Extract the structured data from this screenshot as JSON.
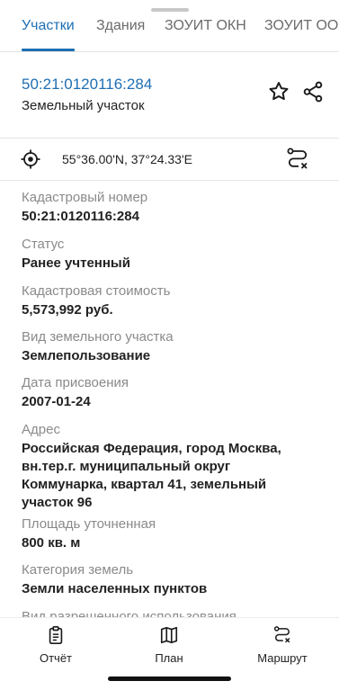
{
  "tabs": [
    {
      "label": "Участки",
      "active": true
    },
    {
      "label": "Здания",
      "active": false
    },
    {
      "label": "ЗОУИТ ОКН",
      "active": false
    },
    {
      "label": "ЗОУИТ ООВ",
      "active": false
    }
  ],
  "header": {
    "cadastral_link": "50:21:0120116:284",
    "object_type": "Земельный участок",
    "icons": [
      "star-icon",
      "share-icon"
    ]
  },
  "coords": {
    "text": "55°36.00'N, 37°24.33'E",
    "icons": [
      "crosshair-icon",
      "route-clear-icon"
    ]
  },
  "details": [
    {
      "label": "Кадастровый номер",
      "value": "50:21:0120116:284"
    },
    {
      "label": "Статус",
      "value": "Ранее учтенный"
    },
    {
      "label": "Кадастровая стоимость",
      "value": "5,573,992 руб."
    },
    {
      "label": "Вид земельного участка",
      "value": "Землепользование"
    },
    {
      "label": "Дата присвоения",
      "value": "2007-01-24"
    },
    {
      "label": "Адрес",
      "value": "Российская Федерация, город Москва, вн.тер.г. муниципальный округ Коммунарка, квартал 41, земельный участок 96"
    },
    {
      "label": "Площадь уточненная",
      "value": "800 кв. м"
    },
    {
      "label": "Категория земель",
      "value": "Земли населенных пунктов"
    },
    {
      "label": "Вид разрешенного использования",
      "value": ""
    }
  ],
  "bottom_nav": [
    {
      "label": "Отчёт",
      "icon": "report-icon"
    },
    {
      "label": "План",
      "icon": "map-icon"
    },
    {
      "label": "Маршрут",
      "icon": "route-icon"
    }
  ],
  "colors": {
    "accent": "#1e6fb4",
    "label_gray": "#8a8a8a",
    "divider": "#e4e4e4"
  }
}
